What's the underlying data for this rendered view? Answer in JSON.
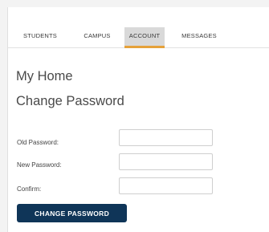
{
  "nav": {
    "tabs": [
      {
        "label": "STUDENTS"
      },
      {
        "label": "CAMPUS"
      },
      {
        "label": "ACCOUNT"
      },
      {
        "label": "MESSAGES"
      }
    ],
    "active_tab": "ACCOUNT"
  },
  "page": {
    "title": "My Home",
    "subtitle": "Change Password"
  },
  "form": {
    "old_password_label": "Old Password:",
    "new_password_label": "New Password:",
    "confirm_label": "Confirm:",
    "old_password_value": "",
    "new_password_value": "",
    "confirm_value": "",
    "submit_label": "CHANGE PASSWORD"
  },
  "colors": {
    "accent": "#e5a13a",
    "button": "#0f3558",
    "active_tab_bg": "#d9d9d9"
  }
}
